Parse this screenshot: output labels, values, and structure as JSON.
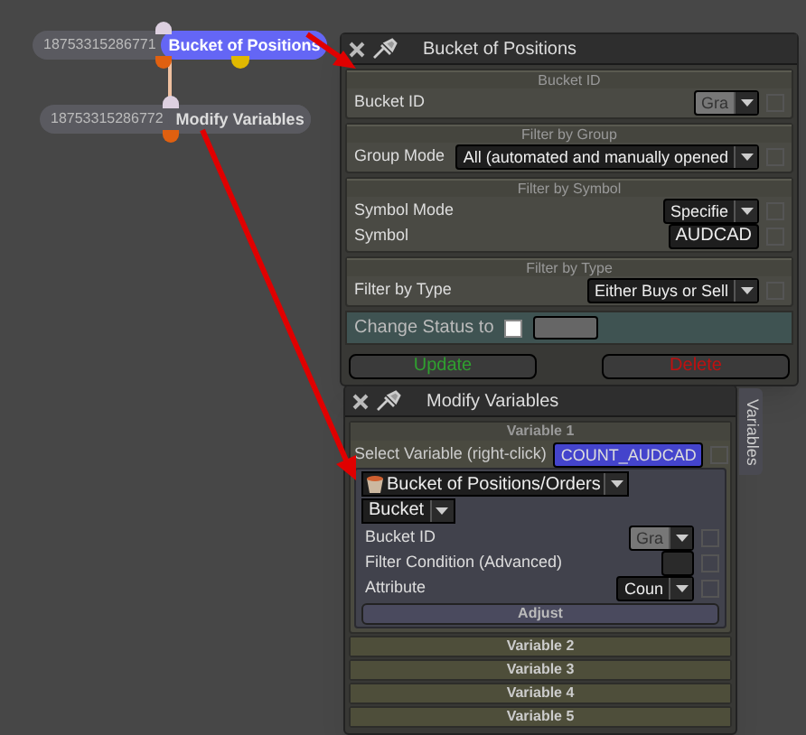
{
  "nodes": [
    {
      "id": "18753315286771",
      "title": "Bucket of Positions",
      "selected": true
    },
    {
      "id": "18753315286772",
      "title": "Modify Variables",
      "selected": false
    }
  ],
  "bucket_window": {
    "title": "Bucket of Positions",
    "sections": [
      {
        "heading": "Bucket ID",
        "rows": [
          {
            "label": "Bucket ID",
            "kind": "dropdown",
            "value": "Gra",
            "disabled": true,
            "checked": false
          }
        ]
      },
      {
        "heading": "Filter by Group",
        "rows": [
          {
            "label": "Group Mode",
            "kind": "dropdown",
            "value": "All (automated and manually opened",
            "disabled": false,
            "checked": false
          }
        ]
      },
      {
        "heading": "Filter by Symbol",
        "rows": [
          {
            "label": "Symbol Mode",
            "kind": "dropdown",
            "value": "Specifie",
            "disabled": false,
            "checked": false
          },
          {
            "label": "Symbol",
            "kind": "text",
            "value": "AUDCAD",
            "checked": false
          }
        ]
      },
      {
        "heading": "Filter by Type",
        "rows": [
          {
            "label": "Filter by Type",
            "kind": "dropdown",
            "value": "Either Buys or Sell",
            "disabled": false,
            "checked": false
          }
        ]
      }
    ],
    "change_status": {
      "label": "Change Status to",
      "checked": false
    },
    "buttons": [
      {
        "label": "Update",
        "kind": "update"
      },
      {
        "label": "Delete",
        "kind": "delete"
      }
    ]
  },
  "variables_window": {
    "title": "Modify Variables",
    "side_tab": "Variables",
    "variables": [
      {
        "heading": "Variable 1",
        "expanded": true,
        "select_label": "Select Variable (right-click)",
        "variable_name": "COUNT_AUDCAD",
        "source": "Bucket of Positions/Orders",
        "source_type": "Bucket",
        "rows": [
          {
            "label": "Bucket ID",
            "kind": "dropdown",
            "value": "Gra",
            "disabled": true,
            "checked": false
          },
          {
            "label": "Filter Condition (Advanced)",
            "kind": "field",
            "checked": false
          },
          {
            "label": "Attribute",
            "kind": "dropdown",
            "value": "Coun",
            "disabled": false,
            "checked": false
          }
        ],
        "action": "Adjust"
      },
      {
        "heading": "Variable 2",
        "expanded": false
      },
      {
        "heading": "Variable 3",
        "expanded": false
      },
      {
        "heading": "Variable 4",
        "expanded": false
      },
      {
        "heading": "Variable 5",
        "expanded": false
      }
    ]
  }
}
